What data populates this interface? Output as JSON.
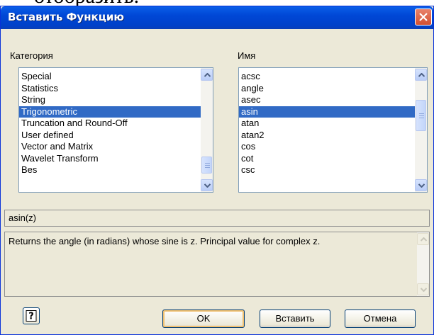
{
  "background_text": "отобразить.",
  "window": {
    "title": "Вставить Функцию"
  },
  "category": {
    "label": "Категория",
    "items": [
      "Special",
      "Statistics",
      "String",
      "Trigonometric",
      "Truncation and Round-Off",
      "User defined",
      "Vector and Matrix",
      "Wavelet Transform",
      "Bes"
    ],
    "selected": "Trigonometric"
  },
  "name": {
    "label": "Имя",
    "items": [
      "acsc",
      "angle",
      "asec",
      "asin",
      "atan",
      "atan2",
      "cos",
      "cot",
      "csc"
    ],
    "selected": "asin"
  },
  "syntax": "asin(z)",
  "description": "Returns the angle (in radians) whose sine is z. Principal value for complex z.",
  "buttons": {
    "help": "?",
    "ok": "OK",
    "insert": "Вставить",
    "cancel": "Отмена"
  },
  "colors": {
    "selection": "#316ac5",
    "dialog_bg": "#ece9d8",
    "titlebar": "#0047d6"
  },
  "icons": {
    "close": "close-icon",
    "help": "help-icon",
    "scroll_up": "chevron-up-icon",
    "scroll_down": "chevron-down-icon"
  }
}
